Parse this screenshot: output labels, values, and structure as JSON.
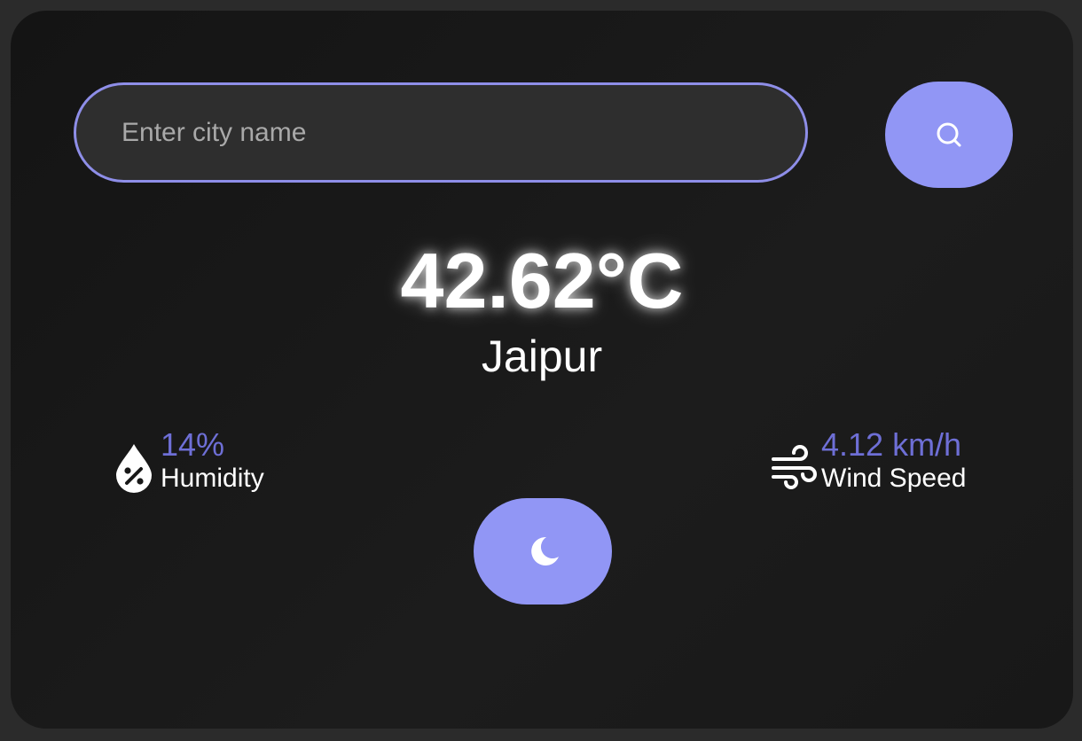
{
  "search": {
    "placeholder": "Enter city name",
    "value": "",
    "button_icon": "search-icon"
  },
  "weather": {
    "temperature": "42.62°C",
    "city": "Jaipur"
  },
  "humidity": {
    "value": "14%",
    "label": "Humidity",
    "icon": "humidity-drop-icon"
  },
  "wind": {
    "value": "4.12 km/h",
    "label": "Wind Speed",
    "icon": "wind-icon"
  },
  "theme_toggle": {
    "icon": "moon-icon"
  },
  "colors": {
    "accent": "#9196f5",
    "value_text": "#6e6fd6",
    "card_background": "#181818",
    "page_background": "#2b2b2b"
  }
}
